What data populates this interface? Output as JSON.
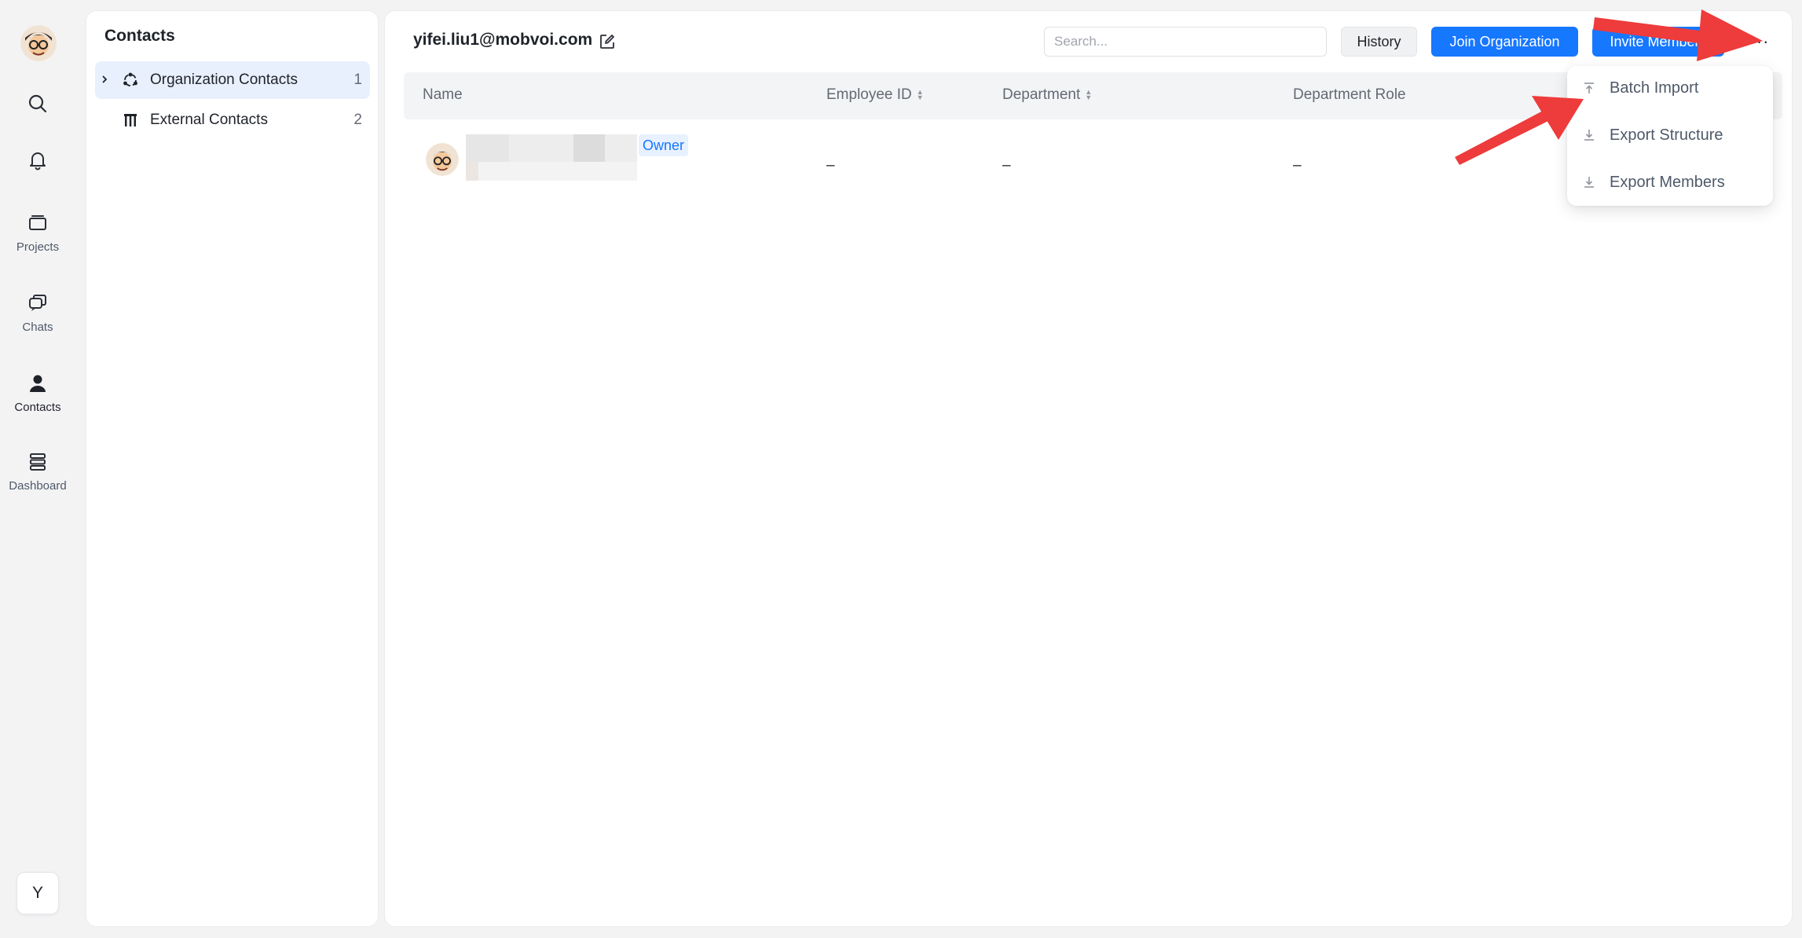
{
  "nav": {
    "items": [
      {
        "label": "",
        "icon": "search-icon"
      },
      {
        "label": "",
        "icon": "bell-icon"
      },
      {
        "label": "Projects",
        "icon": "folder-icon"
      },
      {
        "label": "Chats",
        "icon": "chat-icon"
      },
      {
        "label": "Contacts",
        "icon": "person-icon"
      },
      {
        "label": "Dashboard",
        "icon": "stack-icon"
      }
    ],
    "user_initial": "Y"
  },
  "panel": {
    "title": "Contacts",
    "items": [
      {
        "label": "Organization Contacts",
        "count": "1",
        "icon": "org-icon"
      },
      {
        "label": "External Contacts",
        "count": "2",
        "icon": "building-icon"
      }
    ]
  },
  "main": {
    "org_email": "yifei.liu1@mobvoi.com",
    "search_placeholder": "Search...",
    "history_label": "History",
    "join_label": "Join Organization",
    "invite_label": "Invite Members",
    "more_label": "···"
  },
  "table": {
    "headers": [
      "Name",
      "Employee ID",
      "Department",
      "Department Role"
    ],
    "rows": [
      {
        "badge": "Owner",
        "employee_id": "–",
        "department": "–",
        "role": "–"
      }
    ]
  },
  "menu": {
    "items": [
      {
        "label": "Batch Import",
        "icon": "upload-icon"
      },
      {
        "label": "Export Structure",
        "icon": "download-icon"
      },
      {
        "label": "Export Members",
        "icon": "download-icon"
      }
    ]
  },
  "colors": {
    "accent": "#1677ff",
    "annotation": "#ee3b3b"
  }
}
